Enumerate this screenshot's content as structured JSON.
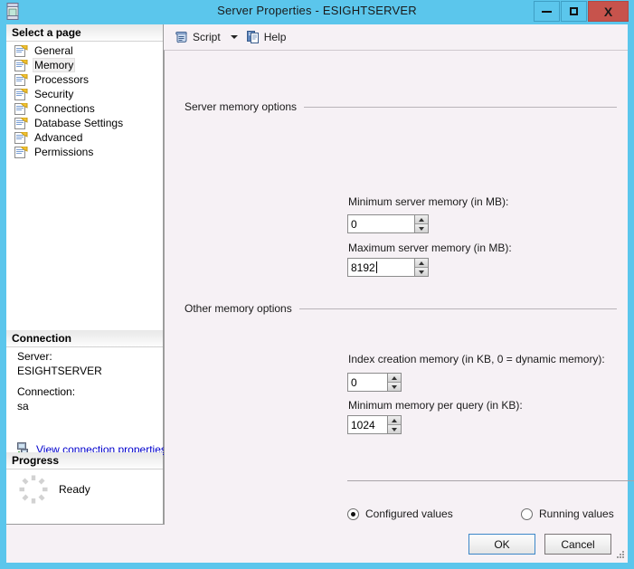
{
  "window": {
    "title": "Server Properties - ESIGHTSERVER",
    "icon": "server-properties-icon",
    "frame_color": "#5BC6EC",
    "close_color": "#C7534C",
    "controls": {
      "minimize": "minimize-icon",
      "maximize": "maximize-icon",
      "close": "X"
    }
  },
  "toolbar": {
    "script_label": "Script",
    "script_icon": "script-scroll-icon",
    "dropdown_icon": "chevron-down-icon",
    "help_label": "Help",
    "help_icon": "help-pages-icon"
  },
  "sidebar": {
    "page_section_title": "Select a page",
    "items": [
      {
        "label": "General",
        "icon": "page-icon",
        "selected": false
      },
      {
        "label": "Memory",
        "icon": "page-icon",
        "selected": true
      },
      {
        "label": "Processors",
        "icon": "page-icon",
        "selected": false
      },
      {
        "label": "Security",
        "icon": "page-icon",
        "selected": false
      },
      {
        "label": "Connections",
        "icon": "page-icon",
        "selected": false
      },
      {
        "label": "Database Settings",
        "icon": "page-icon",
        "selected": false
      },
      {
        "label": "Advanced",
        "icon": "page-icon",
        "selected": false
      },
      {
        "label": "Permissions",
        "icon": "page-icon",
        "selected": false
      }
    ],
    "connection_section_title": "Connection",
    "connection": {
      "server_label": "Server:",
      "server_value": "ESIGHTSERVER",
      "connection_label": "Connection:",
      "connection_value": "sa",
      "view_link": "View connection properties",
      "view_link_icon": "server-connection-icon",
      "link_color": "#0000CC"
    },
    "progress_section_title": "Progress",
    "progress": {
      "status": "Ready",
      "spinner_icon": "progress-spinner-icon"
    }
  },
  "main": {
    "server_memory_group": "Server memory options",
    "other_memory_group": "Other memory options",
    "fields": {
      "min_server_memory_label": "Minimum server memory (in MB):",
      "min_server_memory_value": "0",
      "max_server_memory_label": "Maximum server memory (in MB):",
      "max_server_memory_value": "8192",
      "index_creation_label": "Index creation memory (in KB, 0 = dynamic memory):",
      "index_creation_value": "0",
      "min_memory_per_query_label": "Minimum memory per query (in KB):",
      "min_memory_per_query_value": "1024"
    },
    "value_mode": {
      "configured_label": "Configured values",
      "configured_selected": true,
      "running_label": "Running values",
      "running_selected": false
    }
  },
  "footer": {
    "ok_label": "OK",
    "cancel_label": "Cancel",
    "resize_grip_icon": "resize-grip-icon"
  }
}
